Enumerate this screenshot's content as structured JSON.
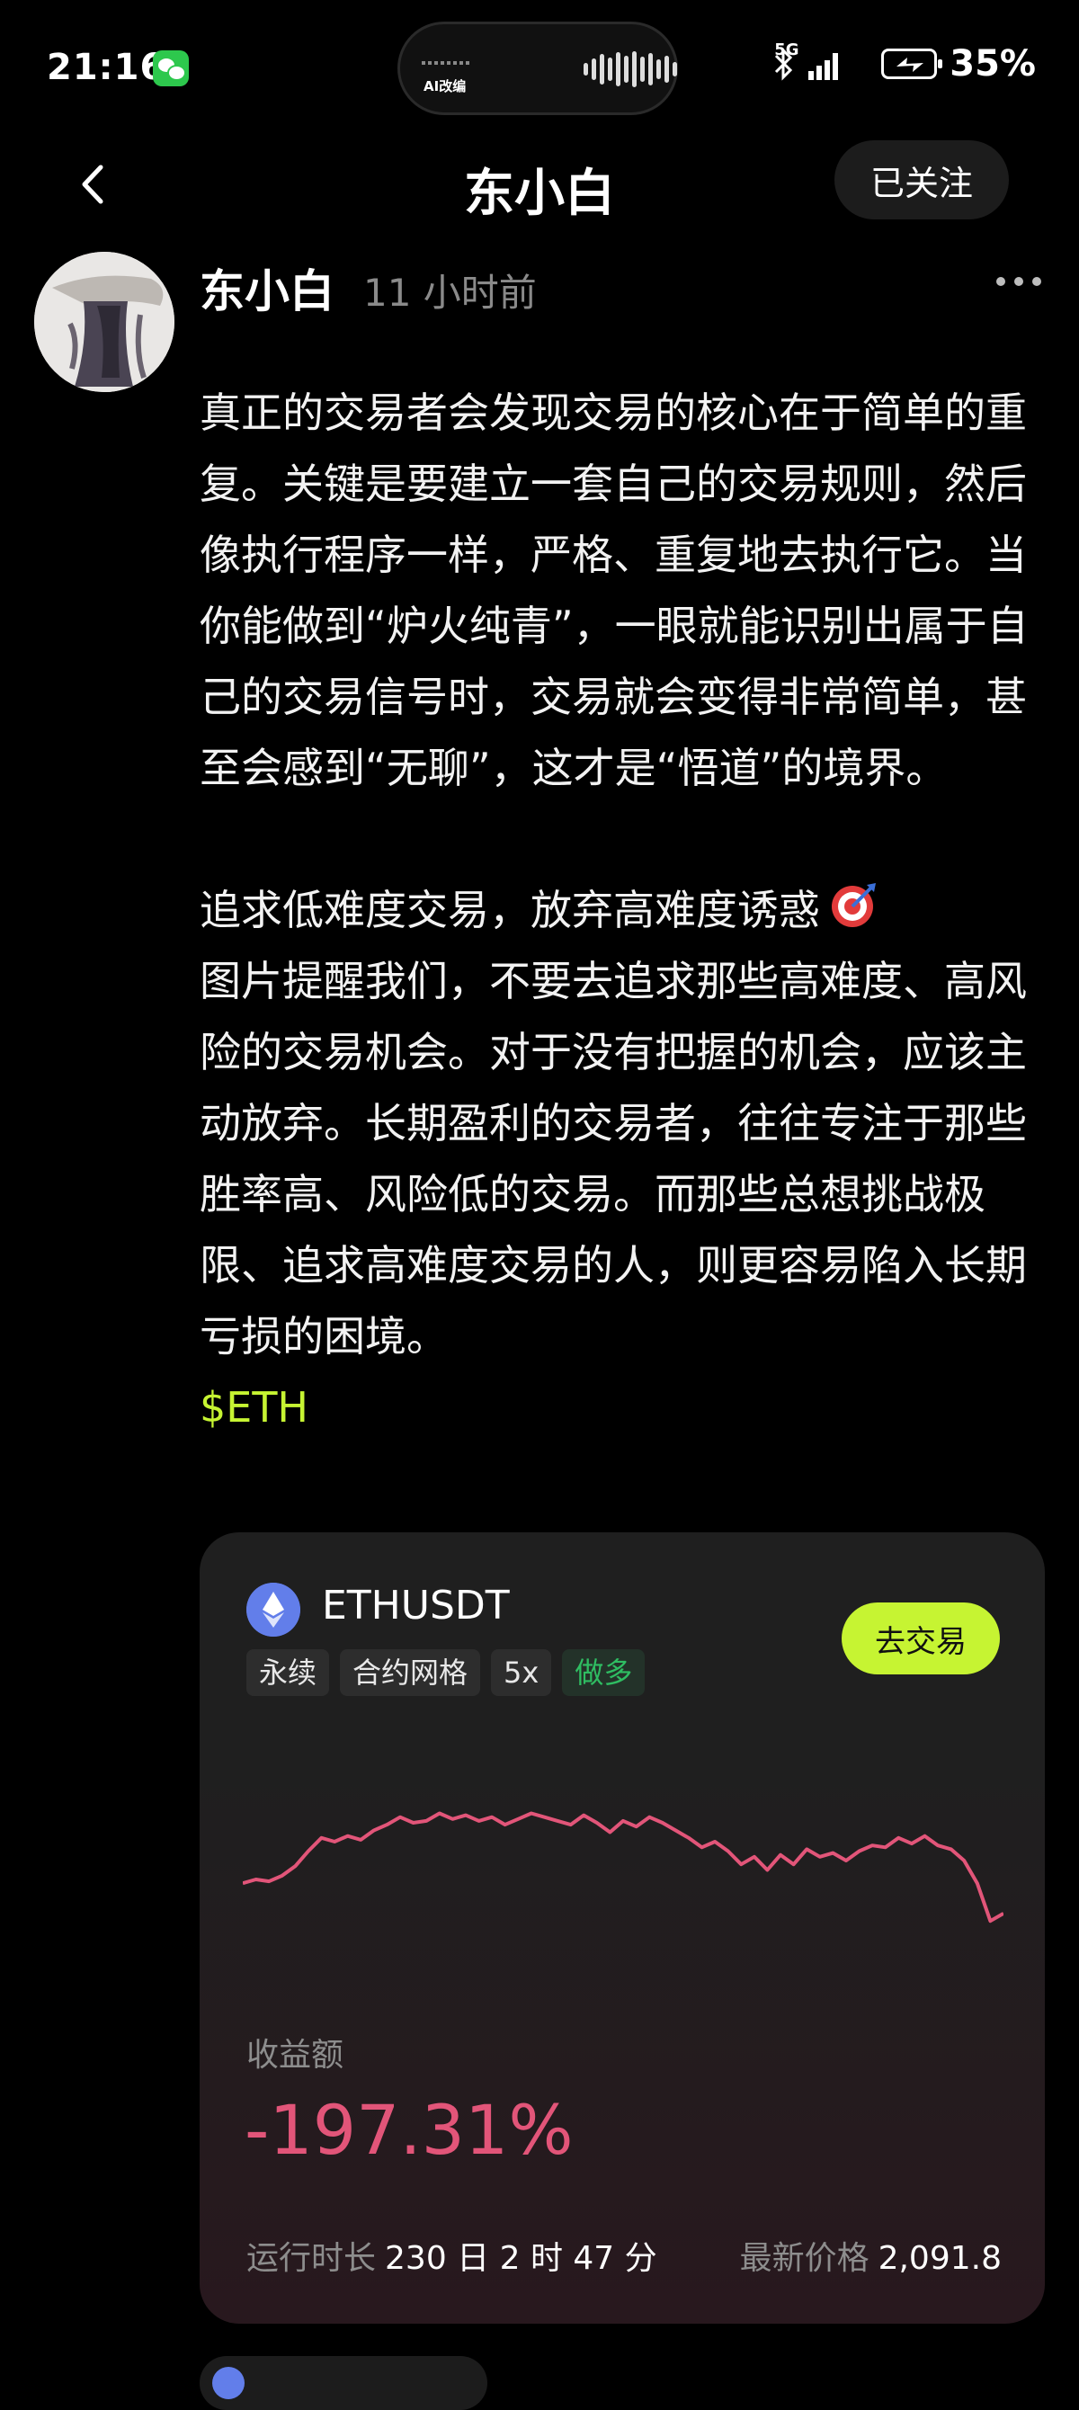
{
  "status_bar": {
    "time": "21:16",
    "network": "5G",
    "battery": "35%"
  },
  "dynamic_island": {
    "label": "AI改编"
  },
  "nav": {
    "title": "东小白",
    "follow_label": "已关注"
  },
  "post": {
    "author": "东小白",
    "time": "11 小时前",
    "paragraph1": "真正的交易者会发现交易的核心在于简单的重复。关键是要建立一套自己的交易规则，然后像执行程序一样，严格、重复地去执行它。当你能做到“炉火纯青”，一眼就能识别出属于自己的交易信号时，交易就会变得非常简单，甚至会感到“无聊”，这才是“悟道”的境界。",
    "paragraph2_title": "追求低难度交易，放弃高难度诱惑",
    "paragraph2": "图片提醒我们，不要去追求那些高难度、高风险的交易机会。对于没有把握的机会，应该主动放弃。长期盈利的交易者，往往专注于那些胜率高、风险低的交易。而那些总想挑战极限、追求高难度交易的人，则更容易陷入长期亏损的困境。",
    "ticker_tag": "$ETH"
  },
  "trade_card": {
    "pair": "ETHUSDT",
    "trade_button": "去交易",
    "tags": [
      "永续",
      "合约网格",
      "5x",
      "做多"
    ],
    "metric_label": "收益额",
    "metric_value": "-197.31%",
    "runtime_label": "运行时长",
    "runtime_value": "230 日 2 时 47 分",
    "price_label": "最新价格",
    "price_value": "2,091.8",
    "colors": {
      "accent": "#c6f432",
      "loss": "#e25579",
      "long": "#2fbd62",
      "eth": "#627eea"
    },
    "sparkline": [
      0.38,
      0.4,
      0.39,
      0.42,
      0.47,
      0.55,
      0.62,
      0.6,
      0.63,
      0.61,
      0.66,
      0.69,
      0.73,
      0.7,
      0.71,
      0.75,
      0.72,
      0.74,
      0.71,
      0.73,
      0.69,
      0.72,
      0.75,
      0.73,
      0.71,
      0.69,
      0.74,
      0.7,
      0.65,
      0.71,
      0.68,
      0.73,
      0.7,
      0.66,
      0.62,
      0.57,
      0.6,
      0.55,
      0.48,
      0.52,
      0.45,
      0.53,
      0.48,
      0.56,
      0.52,
      0.54,
      0.5,
      0.55,
      0.58,
      0.57,
      0.62,
      0.59,
      0.63,
      0.58,
      0.56,
      0.5,
      0.38,
      0.18,
      0.22
    ]
  }
}
